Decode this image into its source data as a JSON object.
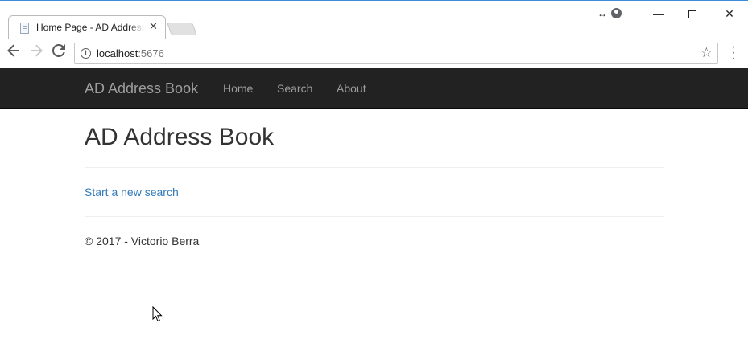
{
  "browser": {
    "tab_title": "Home Page - AD Address Book",
    "tab_close_glyph": "✕",
    "url_host": "localhost",
    "url_port": ":5676"
  },
  "icons": {
    "back": "arrow-left-icon",
    "forward": "arrow-right-icon",
    "reload": "reload-icon",
    "info": "info-icon",
    "star": "star-icon",
    "menu": "kebab-menu-icon"
  },
  "navbar": {
    "brand": "AD Address Book",
    "links": [
      "Home",
      "Search",
      "About"
    ]
  },
  "main": {
    "heading": "AD Address Book",
    "new_search_link": "Start a new search"
  },
  "footer": {
    "text": "© 2017 - Victorio Berra"
  },
  "colors": {
    "navbar_bg": "#222222",
    "navbar_text": "#9d9d9d",
    "link": "#337ab7"
  }
}
